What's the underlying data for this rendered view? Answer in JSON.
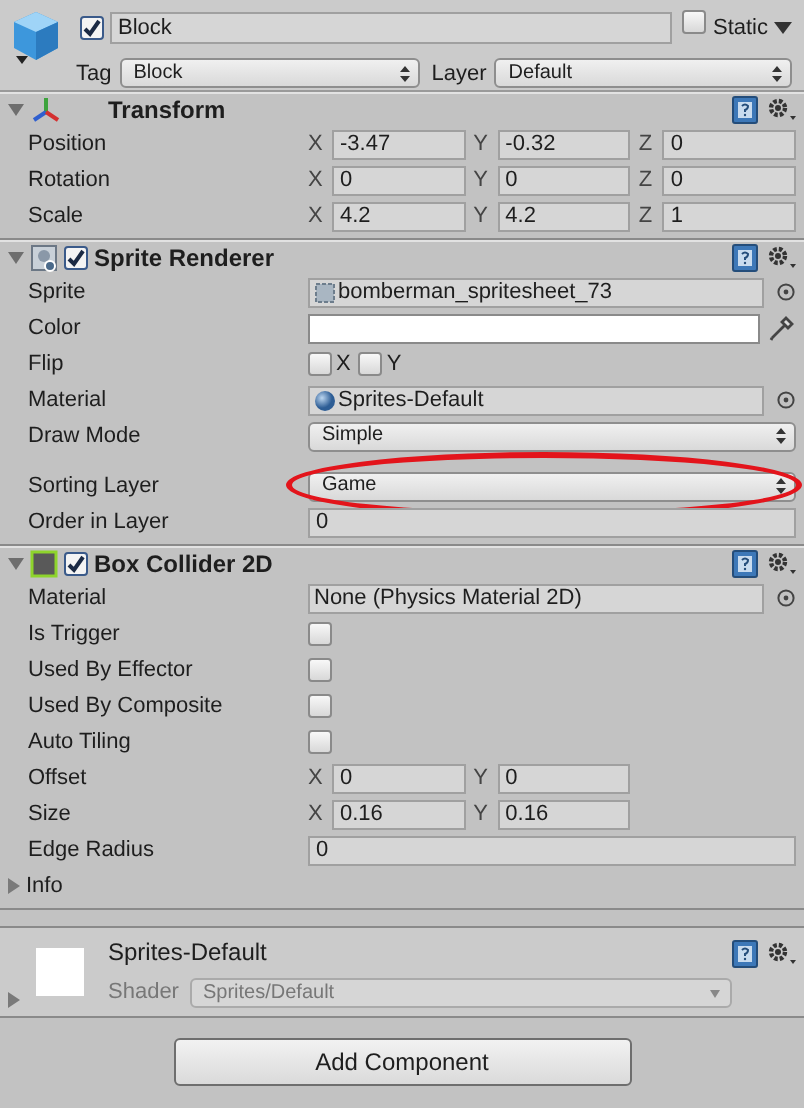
{
  "object": {
    "active": true,
    "name": "Block",
    "static": false,
    "static_label": "Static",
    "tag_label": "Tag",
    "tag": "Block",
    "layer_label": "Layer",
    "layer": "Default"
  },
  "components": [
    {
      "kind": "transform",
      "title": "Transform",
      "expanded": true,
      "rows": [
        {
          "kind": "vector",
          "label": "Position",
          "fields": [
            {
              "axis": "X",
              "value": "-3.47"
            },
            {
              "axis": "Y",
              "value": "-0.32"
            },
            {
              "axis": "Z",
              "value": "0"
            }
          ]
        },
        {
          "kind": "vector",
          "label": "Rotation",
          "fields": [
            {
              "axis": "X",
              "value": "0"
            },
            {
              "axis": "Y",
              "value": "0"
            },
            {
              "axis": "Z",
              "value": "0"
            }
          ]
        },
        {
          "kind": "vector",
          "label": "Scale",
          "fields": [
            {
              "axis": "X",
              "value": "4.2"
            },
            {
              "axis": "Y",
              "value": "4.2"
            },
            {
              "axis": "Z",
              "value": "1"
            }
          ]
        }
      ]
    },
    {
      "kind": "sprite",
      "title": "Sprite Renderer",
      "expanded": true,
      "enabled": true,
      "rows": [
        {
          "kind": "sprite_object",
          "label": "Sprite",
          "value": "bomberman_spritesheet_73"
        },
        {
          "kind": "color",
          "label": "Color",
          "color": "#ffffff"
        },
        {
          "kind": "flip",
          "label": "Flip",
          "options": [
            {
              "label": "X",
              "checked": false
            },
            {
              "label": "Y",
              "checked": false
            }
          ]
        },
        {
          "kind": "material_object",
          "label": "Material",
          "value": "Sprites-Default"
        },
        {
          "kind": "dropdown",
          "label": "Draw Mode",
          "value": "Simple"
        },
        {
          "kind": "dropdown",
          "label": "Sorting Layer",
          "value": "Game",
          "highlighted": true
        },
        {
          "kind": "number",
          "label": "Order in Layer",
          "value": "0"
        }
      ]
    },
    {
      "kind": "collider",
      "title": "Box Collider 2D",
      "expanded": true,
      "enabled": true,
      "rows": [
        {
          "kind": "object",
          "label": "Material",
          "value": "None (Physics Material 2D)"
        },
        {
          "kind": "checkbox",
          "label": "Is Trigger",
          "checked": false
        },
        {
          "kind": "checkbox",
          "label": "Used By Effector",
          "checked": false
        },
        {
          "kind": "checkbox",
          "label": "Used By Composite",
          "checked": false
        },
        {
          "kind": "checkbox",
          "label": "Auto Tiling",
          "checked": false
        },
        {
          "kind": "vector",
          "label": "Offset",
          "fields": [
            {
              "axis": "X",
              "value": "0"
            },
            {
              "axis": "Y",
              "value": "0"
            }
          ]
        },
        {
          "kind": "vector",
          "label": "Size",
          "fields": [
            {
              "axis": "X",
              "value": "0.16"
            },
            {
              "axis": "Y",
              "value": "0.16"
            }
          ]
        },
        {
          "kind": "number",
          "label": "Edge Radius",
          "value": "0"
        },
        {
          "kind": "foldout",
          "label": "Info",
          "expanded": false
        }
      ]
    }
  ],
  "material": {
    "name": "Sprites-Default",
    "expanded": false,
    "shader_label": "Shader",
    "shader": "Sprites/Default"
  },
  "add_button": "Add Component"
}
